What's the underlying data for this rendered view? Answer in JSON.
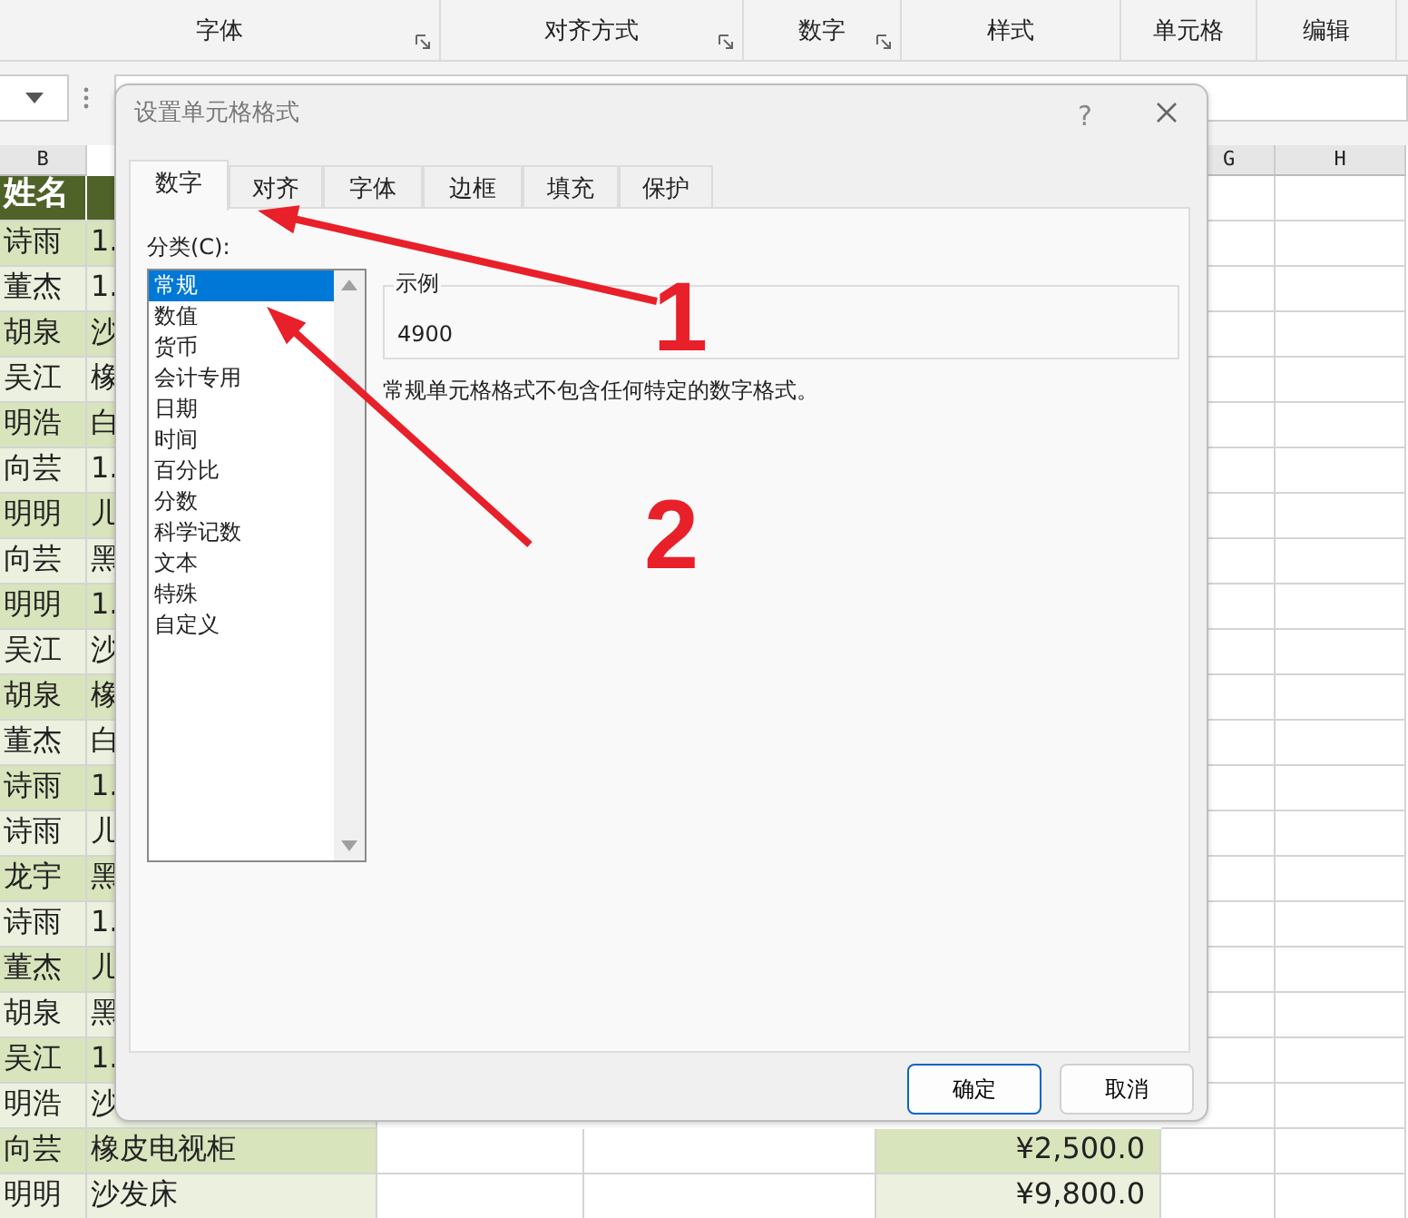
{
  "ribbon": {
    "groups": [
      {
        "label": "字体",
        "launcher": true
      },
      {
        "label": "对齐方式",
        "launcher": true
      },
      {
        "label": "数字",
        "launcher": true
      },
      {
        "label": "样式",
        "launcher": false
      },
      {
        "label": "单元格",
        "launcher": false
      },
      {
        "label": "编辑",
        "launcher": false
      }
    ]
  },
  "sheet": {
    "column_headers": [
      {
        "letter": "B"
      },
      {
        "letter": "G"
      },
      {
        "letter": "H"
      }
    ],
    "header": {
      "name": "姓名"
    },
    "rows": [
      {
        "name": "诗雨",
        "column_c": "1."
      },
      {
        "name": "董杰",
        "column_c": "1."
      },
      {
        "name": "胡泉",
        "column_c": "沙"
      },
      {
        "name": "吴江",
        "column_c": "橡"
      },
      {
        "name": "明浩",
        "column_c": "白"
      },
      {
        "name": "向芸",
        "column_c": "1."
      },
      {
        "name": "明明",
        "column_c": "儿"
      },
      {
        "name": "向芸",
        "column_c": "黑"
      },
      {
        "name": "明明",
        "column_c": "1."
      },
      {
        "name": "吴江",
        "column_c": "沙"
      },
      {
        "name": "胡泉",
        "column_c": "橡"
      },
      {
        "name": "董杰",
        "column_c": "白"
      },
      {
        "name": "诗雨",
        "column_c": "1."
      },
      {
        "name": "诗雨",
        "column_c": "儿"
      },
      {
        "name": "龙宇",
        "column_c": "黑"
      },
      {
        "name": "诗雨",
        "column_c": "1."
      },
      {
        "name": "董杰",
        "column_c": "儿"
      },
      {
        "name": "胡泉",
        "column_c": "黑"
      },
      {
        "name": "吴江",
        "column_c": "1."
      },
      {
        "name": "明浩",
        "column_c": "沙"
      },
      {
        "name": "向芸",
        "column_c": "橡皮电视柜",
        "column_f": "¥2,500.0"
      },
      {
        "name": "明明",
        "column_c": "沙发床",
        "column_f": "¥9,800.0"
      }
    ]
  },
  "dialog": {
    "title": "设置单元格格式",
    "help": "?",
    "tabs": [
      {
        "label": "数字",
        "selected": true
      },
      {
        "label": "对齐",
        "selected": false
      },
      {
        "label": "字体",
        "selected": false
      },
      {
        "label": "边框",
        "selected": false
      },
      {
        "label": "填充",
        "selected": false
      },
      {
        "label": "保护",
        "selected": false
      }
    ],
    "category_label": "分类(C):",
    "categories": [
      {
        "label": "常规",
        "selected": true
      },
      {
        "label": "数值",
        "selected": false
      },
      {
        "label": "货币",
        "selected": false
      },
      {
        "label": "会计专用",
        "selected": false
      },
      {
        "label": "日期",
        "selected": false
      },
      {
        "label": "时间",
        "selected": false
      },
      {
        "label": "百分比",
        "selected": false
      },
      {
        "label": "分数",
        "selected": false
      },
      {
        "label": "科学记数",
        "selected": false
      },
      {
        "label": "文本",
        "selected": false
      },
      {
        "label": "特殊",
        "selected": false
      },
      {
        "label": "自定义",
        "selected": false
      }
    ],
    "sample": {
      "legend": "示例",
      "value": "4900"
    },
    "description": "常规单元格格式不包含任何特定的数字格式。",
    "buttons": [
      {
        "label": "确定",
        "default": true
      },
      {
        "label": "取消",
        "default": false
      }
    ]
  },
  "annotations": [
    {
      "label": "1"
    },
    {
      "label": "2"
    }
  ]
}
